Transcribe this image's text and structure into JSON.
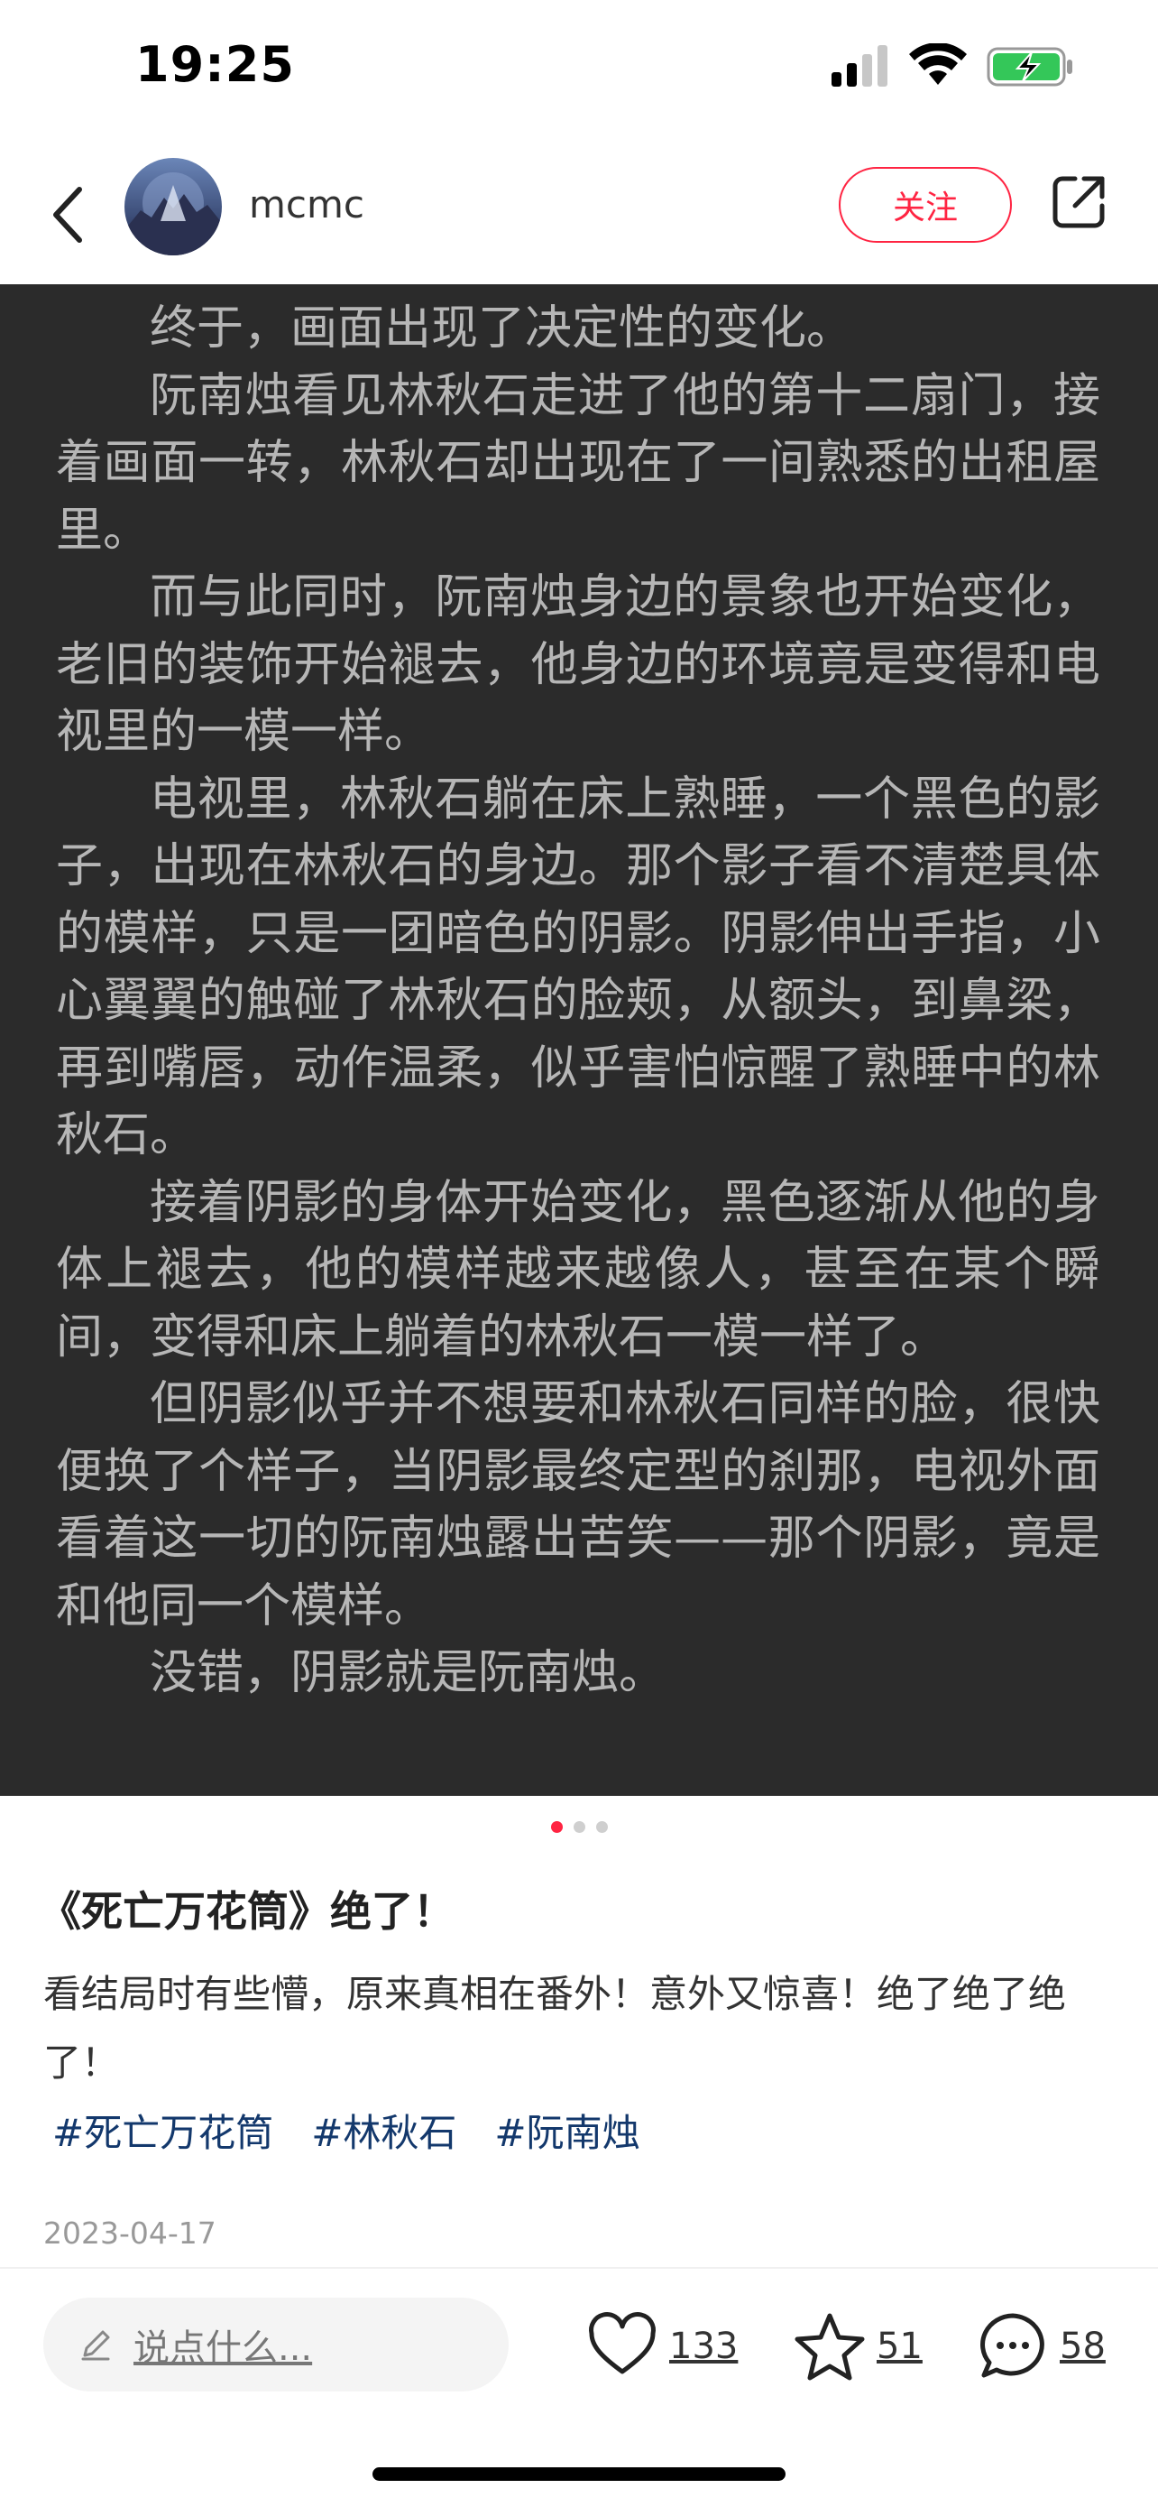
{
  "status_bar": {
    "time": "19:25"
  },
  "header": {
    "username": "mcmc",
    "follow_label": "关注",
    "accent_color": "#ff2442"
  },
  "image_text": [
    "终于，画面出现了决定性的变化。",
    "阮南烛看见林秋石走进了他的第十二扇门，接着画面一转，林秋石却出现在了一间熟悉的出租屋里。",
    "而与此同时，阮南烛身边的景象也开始变化，老旧的装饰开始褪去，他身边的环境竟是变得和电视里的一模一样。",
    "电视里，林秋石躺在床上熟睡，一个黑色的影子，出现在林秋石的身边。那个影子看不清楚具体的模样，只是一团暗色的阴影。阴影伸出手指，小心翼翼的触碰了林秋石的脸颊，从额头，到鼻梁，再到嘴唇，动作温柔，似乎害怕惊醒了熟睡中的林秋石。",
    "接着阴影的身体开始变化，黑色逐渐从他的身体上褪去，他的模样越来越像人，甚至在某个瞬间，变得和床上躺着的林秋石一模一样了。",
    "但阴影似乎并不想要和林秋石同样的脸，很快便换了个样子，当阴影最终定型的刹那，电视外面看着这一切的阮南烛露出苦笑——那个阴影，竟是和他同一个模样。",
    "没错，阴影就是阮南烛。"
  ],
  "pagination": {
    "total": 3,
    "current": 1
  },
  "post": {
    "title": "《死亡万花筒》绝了！",
    "body": "看结局时有些懵，原来真相在番外！意外又惊喜！绝了绝了绝了！",
    "tags": [
      "#死亡万花筒",
      "#林秋石",
      "#阮南烛"
    ],
    "date": "2023-04-17"
  },
  "bottom_bar": {
    "comment_placeholder": "说点什么...",
    "likes": "133",
    "favorites": "51",
    "comments": "58"
  }
}
